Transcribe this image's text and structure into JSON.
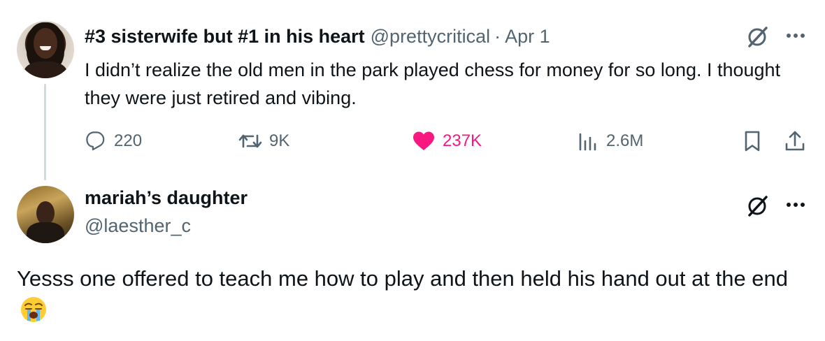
{
  "reply_parent": {
    "author": {
      "display_name": "#3 sisterwife but #1 in his heart",
      "handle": "@prettycritical",
      "separator": "·",
      "date": "Apr 1"
    },
    "text": "I didn’t realize the old men in the park played chess for money for so long. I thought they were just retired and vibing.",
    "stats": {
      "replies": "220",
      "reposts": "9K",
      "likes": "237K",
      "views": "2.6M"
    },
    "like_color": "#f91880",
    "icons": [
      "grok-icon",
      "more-icon",
      "reply-icon",
      "repost-icon",
      "heart-icon",
      "views-icon",
      "bookmark-icon",
      "share-icon"
    ]
  },
  "reply": {
    "author": {
      "display_name": "mariah’s daughter",
      "handle": "@laesther_c"
    },
    "text": "Yesss one offered to teach me how to play and then held his hand out at the end",
    "emoji": "loudly-crying-face-emoji",
    "icons": [
      "grok-icon",
      "more-icon"
    ]
  },
  "colors": {
    "primary_text": "#0f1419",
    "secondary_text": "#536471",
    "thread_line": "#cfd9de"
  }
}
